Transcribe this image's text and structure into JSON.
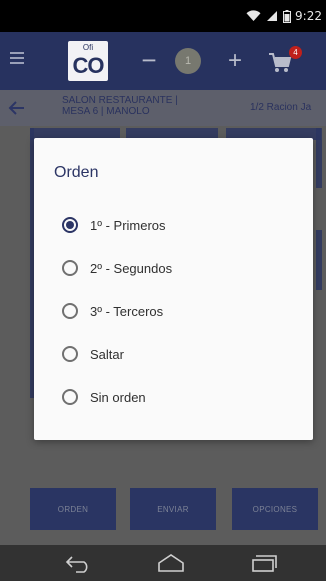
{
  "status_bar": {
    "time": "9:22",
    "icons": [
      "wifi-icon",
      "signal-icon",
      "battery-icon"
    ]
  },
  "app_bar": {
    "logo_sup": "Ofi",
    "logo_main": "CO",
    "quantity": "1",
    "minus_label": "−",
    "plus_label": "+",
    "cart_count": "4"
  },
  "sub_bar": {
    "location": "SALON RESTAURANTE |\nMESA 6 | MANOLO",
    "item": "1/2 Racion Ja"
  },
  "dialog": {
    "title": "Orden",
    "selected_index": 0,
    "options": [
      {
        "label": "1º - Primeros"
      },
      {
        "label": "2º - Segundos"
      },
      {
        "label": "3º - Terceros"
      },
      {
        "label": "Saltar"
      },
      {
        "label": "Sin orden"
      }
    ]
  },
  "bottom_buttons": {
    "orden": "ORDEN",
    "enviar": "ENVIAR",
    "opciones": "OPCIONES"
  },
  "colors": {
    "primary": "#27325f",
    "badge": "#c0201b",
    "dialog_bg": "#fafafa"
  }
}
